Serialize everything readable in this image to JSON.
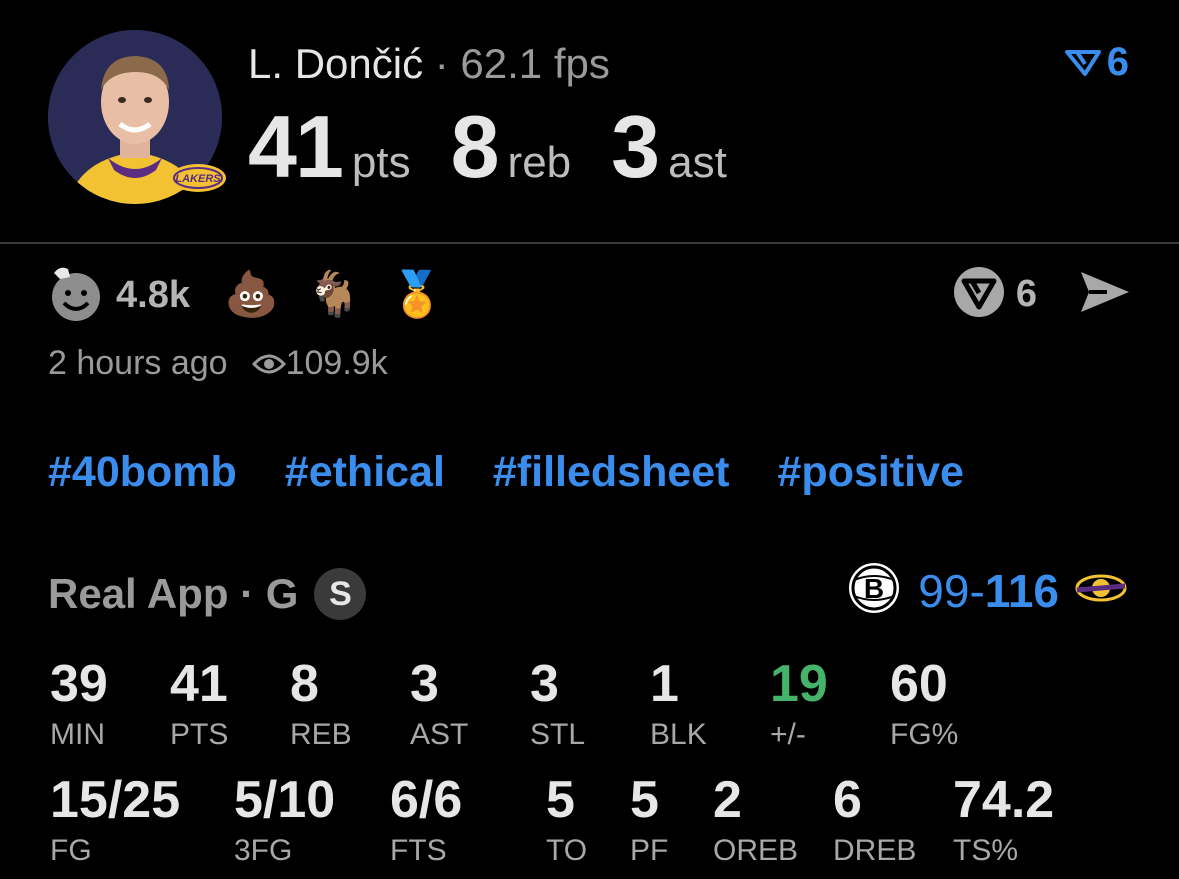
{
  "header": {
    "player_name": "L. Dončić",
    "separator": "·",
    "fps": "62.1 fps",
    "filter_count": "6",
    "line": [
      {
        "value": "41",
        "unit": "pts"
      },
      {
        "value": "8",
        "unit": "reb"
      },
      {
        "value": "3",
        "unit": "ast"
      }
    ]
  },
  "reactions": {
    "count": "4.8k",
    "emojis": [
      "💩",
      "🐐",
      "🏅"
    ],
    "share_count": "6"
  },
  "meta": {
    "time": "2 hours ago",
    "views": "109.9k"
  },
  "tags": [
    "#40bomb",
    "#ethical",
    "#filledsheet",
    "#positive"
  ],
  "game": {
    "source": "Real App · G",
    "badge": "S",
    "score_left": "99",
    "score_dash": "-",
    "score_right": "116",
    "team_logo_text": "LAKERS"
  },
  "stats_row1": [
    {
      "value": "39",
      "label": "MIN"
    },
    {
      "value": "41",
      "label": "PTS"
    },
    {
      "value": "8",
      "label": "REB"
    },
    {
      "value": "3",
      "label": "AST"
    },
    {
      "value": "3",
      "label": "STL"
    },
    {
      "value": "1",
      "label": "BLK"
    },
    {
      "value": "19",
      "label": "+/-"
    },
    {
      "value": "60",
      "label": "FG%"
    }
  ],
  "stats_row2": [
    {
      "value": "15/25",
      "label": "FG"
    },
    {
      "value": "5/10",
      "label": "3FG"
    },
    {
      "value": "6/6",
      "label": "FTS"
    },
    {
      "value": "5",
      "label": "TO"
    },
    {
      "value": "5",
      "label": "PF"
    },
    {
      "value": "2",
      "label": "OREB"
    },
    {
      "value": "6",
      "label": "DREB"
    },
    {
      "value": "74.2",
      "label": "TS%"
    }
  ],
  "colors": {
    "accent": "#3b8ded",
    "positive": "#46b36a",
    "background": "#000000"
  }
}
